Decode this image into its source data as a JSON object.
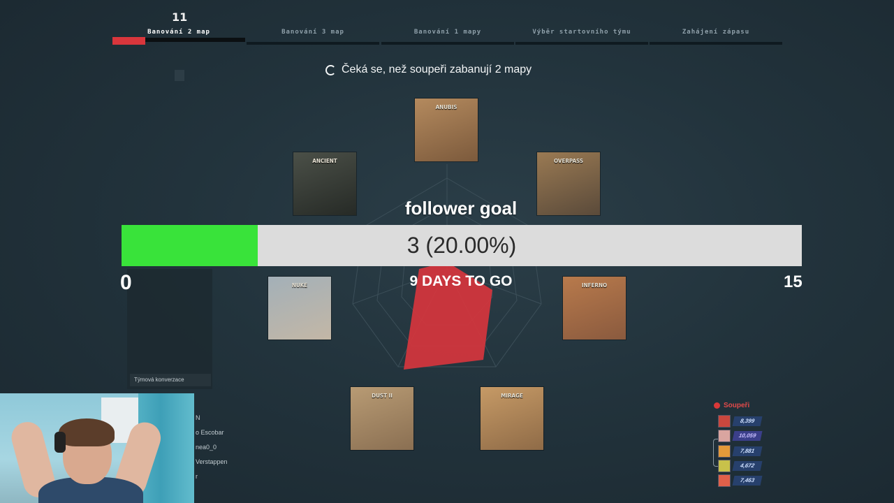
{
  "top_bar": {
    "timer": "11",
    "phases": [
      {
        "label": "Banování 2 map",
        "active": true
      },
      {
        "label": "Banování 3 map",
        "active": false
      },
      {
        "label": "Banování 1 mapy",
        "active": false
      },
      {
        "label": "Výběr startovního týmu",
        "active": false
      },
      {
        "label": "Zahájení zápasu",
        "active": false
      }
    ],
    "progress_fraction": 0.3
  },
  "status_message": "Čeká se, než soupeři zabanují 2 mapy",
  "maps": [
    {
      "name": "ANUBIS",
      "colors": [
        "#b48a5e",
        "#7c5a3c"
      ]
    },
    {
      "name": "ANCIENT",
      "colors": [
        "#4b5048",
        "#262a26"
      ]
    },
    {
      "name": "OVERPASS",
      "colors": [
        "#9a7a53",
        "#5a4a3a"
      ]
    },
    {
      "name": "NUKE",
      "colors": [
        "#a3b0b8",
        "#c3b7a6"
      ]
    },
    {
      "name": "INFERNO",
      "colors": [
        "#b87a4c",
        "#8a5a3e"
      ]
    },
    {
      "name": "DUST II",
      "colors": [
        "#b89b74",
        "#8a6f52"
      ]
    },
    {
      "name": "MIRAGE",
      "colors": [
        "#c69a66",
        "#8f6b47"
      ]
    }
  ],
  "follower_goal": {
    "title": "follower goal",
    "value_text": "3 (20.00%)",
    "fraction": 0.2,
    "min": "0",
    "max": "15",
    "days_left": "9 DAYS TO GO"
  },
  "chat": {
    "tab_label": "Týmová konverzace"
  },
  "team_players": [
    "N",
    "o Escobar",
    "nea0_0",
    "Verstappen",
    "r"
  ],
  "opponents": {
    "title": "Soupeři",
    "players": [
      {
        "rank": "8,399",
        "avatar_color": "#c9473e",
        "tier": "normal"
      },
      {
        "rank": "10,059",
        "avatar_color": "#d9a5a0",
        "tier": "high"
      },
      {
        "rank": "7,881",
        "avatar_color": "#e39a3a",
        "tier": "normal"
      },
      {
        "rank": "4,672",
        "avatar_color": "#c8c14a",
        "tier": "normal"
      },
      {
        "rank": "7,463",
        "avatar_color": "#e0604a",
        "tier": "normal"
      }
    ]
  }
}
